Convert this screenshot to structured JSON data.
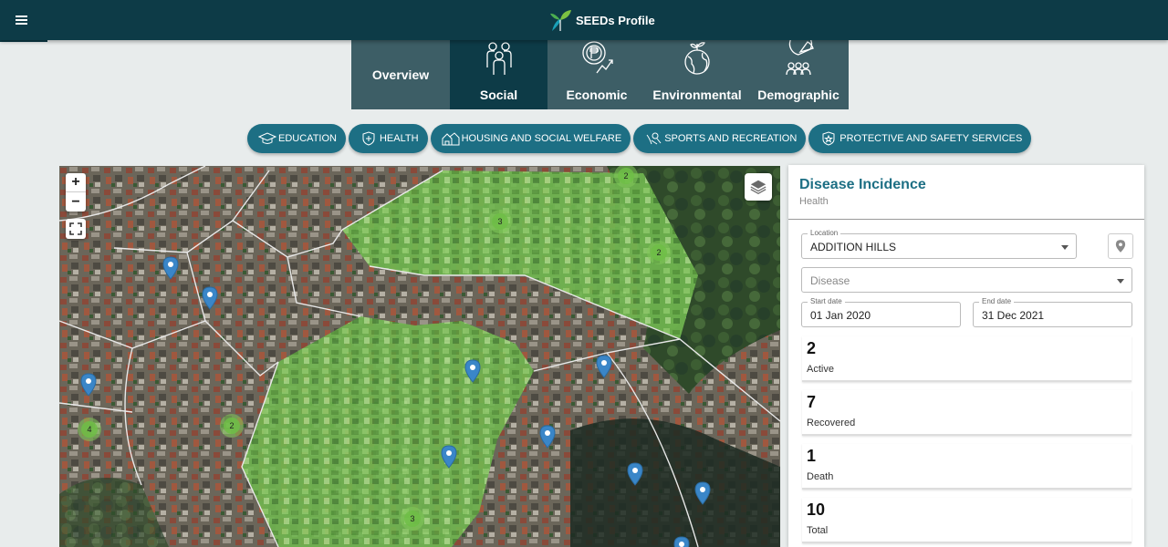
{
  "app": {
    "title": "SEEDs Profile"
  },
  "header": {
    "menu_icon": "hamburger-menu-icon",
    "logo_icon": "seedling-logo-icon"
  },
  "categories": [
    {
      "label": "Overview",
      "icon": "",
      "active": false
    },
    {
      "label": "Social",
      "icon": "people-group-icon",
      "active": true
    },
    {
      "label": "Economic",
      "icon": "peso-growth-icon",
      "active": false
    },
    {
      "label": "Environmental",
      "icon": "globe-plant-icon",
      "active": false
    },
    {
      "label": "Demographic",
      "icon": "population-chart-icon",
      "active": false
    }
  ],
  "subcategories": [
    {
      "label": "EDUCATION",
      "icon": "graduation-cap-icon"
    },
    {
      "label": "HEALTH",
      "icon": "health-shield-icon"
    },
    {
      "label": "HOUSING AND SOCIAL WELFARE",
      "icon": "houses-icon"
    },
    {
      "label": "SPORTS AND RECREATION",
      "icon": "sports-icon"
    },
    {
      "label": "PROTECTIVE AND SAFETY SERVICES",
      "icon": "police-badge-icon"
    }
  ],
  "map": {
    "zoom_in": "+",
    "zoom_out": "−",
    "clusters": [
      "2",
      "3",
      "2",
      "4",
      "2",
      "3"
    ]
  },
  "panel": {
    "title": "Disease Incidence",
    "subtitle": "Health",
    "location": {
      "legend": "Location",
      "value": "ADDITION HILLS"
    },
    "disease": {
      "placeholder": "Disease"
    },
    "start_date": {
      "legend": "Start date",
      "value": "01 Jan 2020"
    },
    "end_date": {
      "legend": "End date",
      "value": "31 Dec 2021"
    },
    "stats": [
      {
        "value": "2",
        "label": "Active"
      },
      {
        "value": "7",
        "label": "Recovered"
      },
      {
        "value": "1",
        "label": "Death"
      },
      {
        "value": "10",
        "label": "Total"
      }
    ]
  },
  "colors": {
    "header": "#0d3b47",
    "accent": "#1d6f84",
    "category": "#3d5e66"
  }
}
